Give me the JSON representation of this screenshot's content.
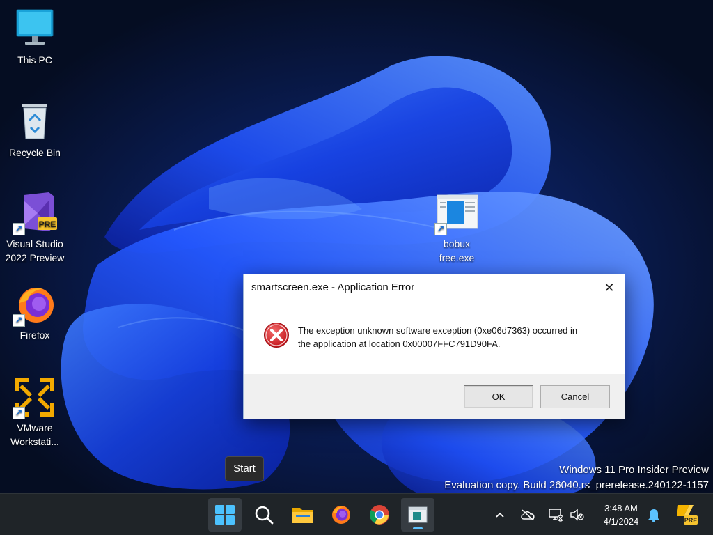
{
  "desktop": {
    "icons": [
      {
        "label": "This PC",
        "icon": "monitor-icon"
      },
      {
        "label": "Recycle Bin",
        "icon": "recycle-bin-icon"
      },
      {
        "label_line1": "Visual Studio",
        "label_line2": "2022 Preview",
        "badge": "PRE",
        "icon": "visual-studio-icon"
      },
      {
        "label": "Firefox",
        "icon": "firefox-icon"
      },
      {
        "label_line1": "VMware",
        "label_line2": "Workstati...",
        "icon": "vmware-icon"
      },
      {
        "label_line1": "bobux",
        "label_line2": "free.exe",
        "icon": "exe-file-icon"
      }
    ],
    "watermark": {
      "line1": "Windows 11 Pro Insider Preview",
      "line2": "Evaluation copy. Build 26040.rs_prerelease.240122-1157"
    },
    "tooltip": "Start"
  },
  "dialog": {
    "title": "smartscreen.exe - Application Error",
    "close_glyph": "✕",
    "message_line1": "The exception unknown software exception (0xe06d7363) occurred in",
    "message_line2": "the application at location 0x00007FFC791D90FA.",
    "ok_label": "OK",
    "cancel_label": "Cancel"
  },
  "taskbar": {
    "pinned": [
      "start-icon",
      "search-icon",
      "file-explorer-icon",
      "firefox-icon",
      "chrome-icon",
      "app-window-icon"
    ],
    "active": "app-window-icon",
    "tray": [
      "chevron-up-icon",
      "onedrive-icon",
      "network-icon",
      "volume-muted-icon"
    ],
    "time": "3:48 AM",
    "date": "4/1/2024",
    "badge": "PRE",
    "accent": "#5cc2ff"
  }
}
